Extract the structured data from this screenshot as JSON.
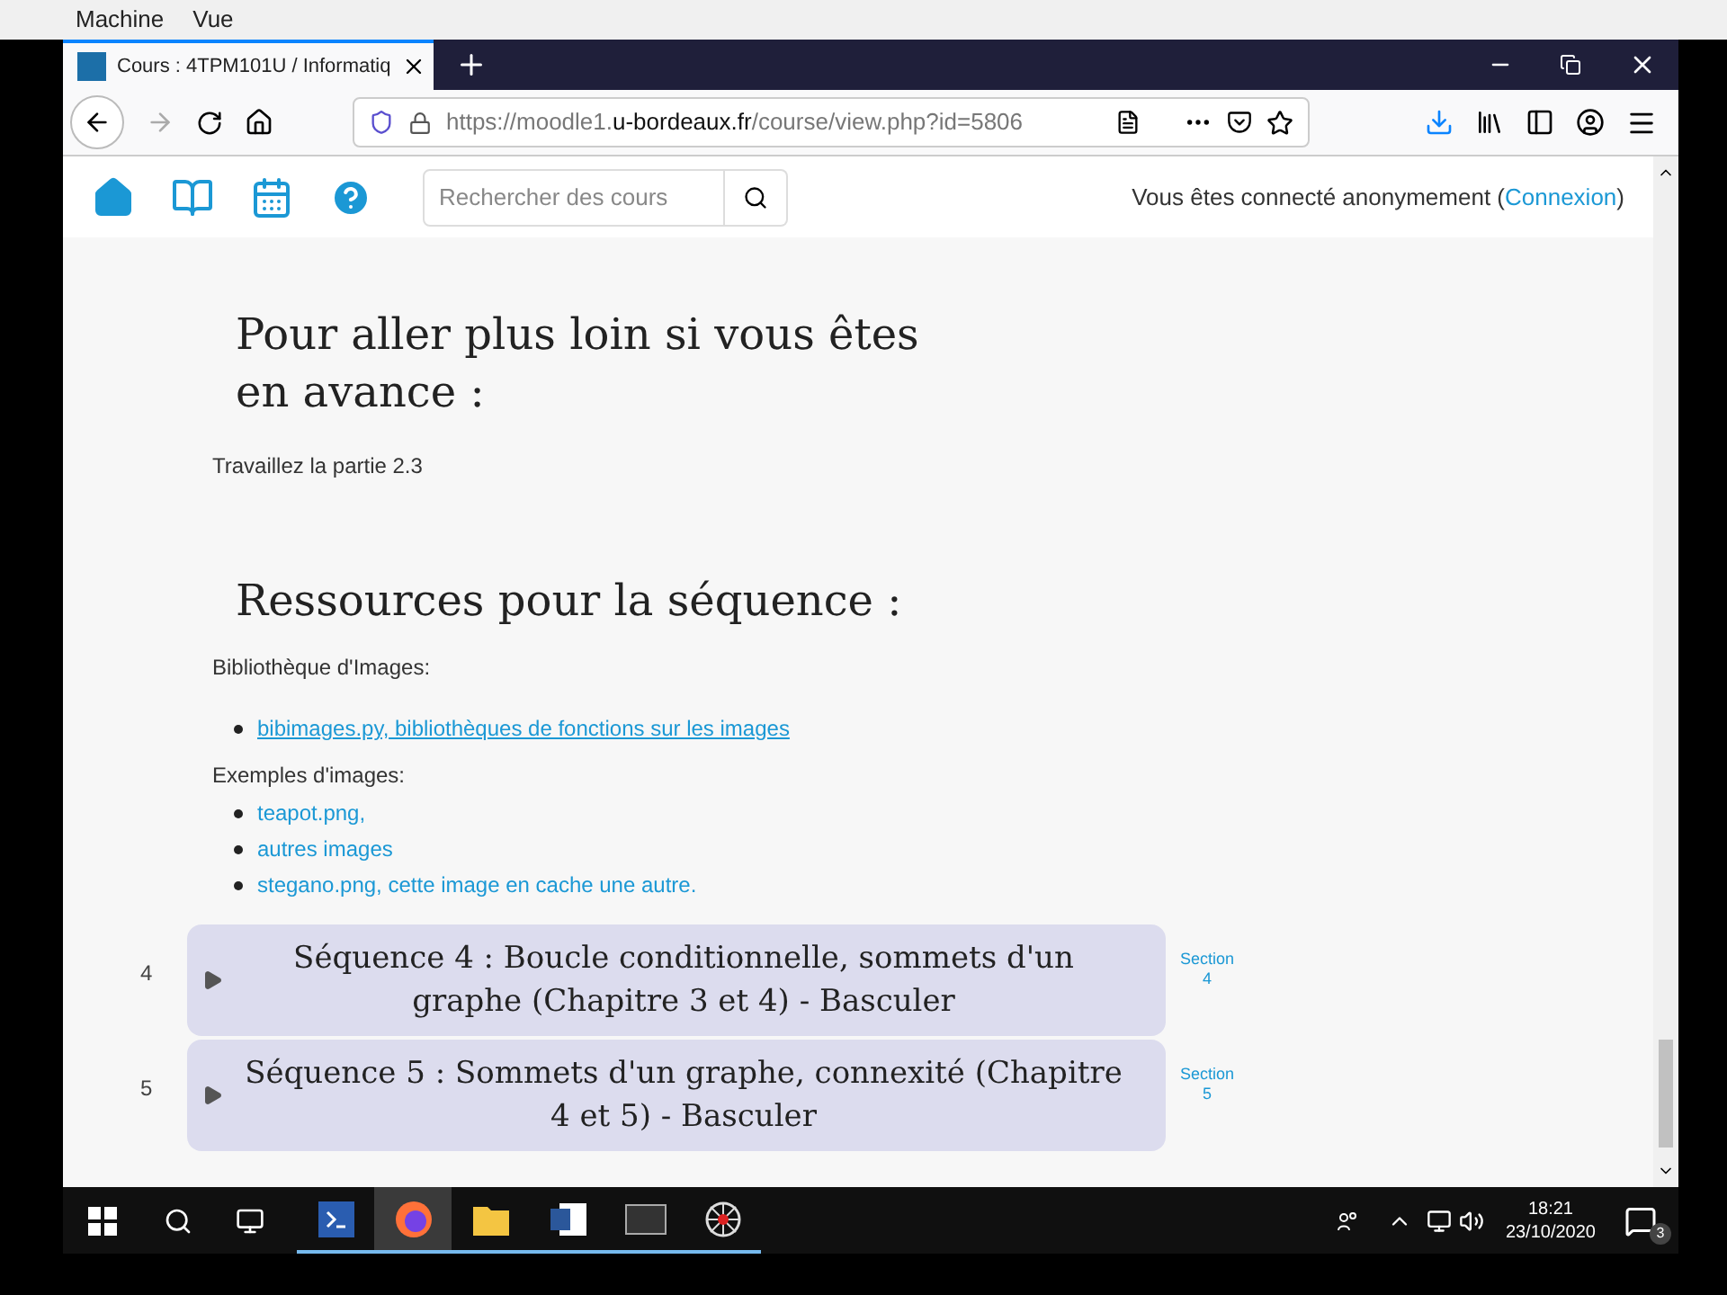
{
  "vm_menu": [
    "Machine",
    "Vue"
  ],
  "browser": {
    "tab_title": "Cours : 4TPM101U / Informatiq",
    "url_prefix": "https://moodle1.",
    "url_domain": "u-bordeaux.fr",
    "url_path": "/course/view.php?id=5806"
  },
  "moodle_header": {
    "search": {
      "placeholder": "Rechercher des cours"
    },
    "login_text": "Vous êtes connecté anonymement (",
    "login_link": "Connexion",
    "login_close": ")"
  },
  "content": {
    "heading_1": "Pour aller plus loin si vous êtes en avance :",
    "text_1": "Travaillez la partie 2.3",
    "heading_2": "Ressources pour la séquence :",
    "label_1": "Bibliothèque d'Images:",
    "list_1": [
      "bibimages.py, bibliothèques de fonctions sur les images"
    ],
    "label_2": "Exemples d'images:",
    "list_2": [
      "teapot.png,",
      "autres images",
      "stegano.png, cette image en cache une autre."
    ]
  },
  "sections": [
    {
      "number": "4",
      "title": "Séquence 4 : Boucle conditionnelle, sommets d'un graphe (Chapitre 3 et 4) - Basculer",
      "expanded": false,
      "link": [
        "Section",
        "4"
      ]
    },
    {
      "number": "5",
      "title": "Séquence 5 : Sommets d'un graphe, connexité (Chapitre 4 et 5) - Basculer",
      "expanded": false,
      "link": [
        "Section",
        "5"
      ]
    }
  ],
  "taskbar": {
    "apps": [
      {
        "kind": "powershell",
        "running": true,
        "selected": false
      },
      {
        "kind": "firefox",
        "running": true,
        "selected": true
      },
      {
        "kind": "explorer",
        "running": true,
        "selected": false
      },
      {
        "kind": "word",
        "running": true,
        "selected": false
      },
      {
        "kind": "terminal",
        "running": true,
        "selected": false
      },
      {
        "kind": "spider",
        "running": true,
        "selected": false
      }
    ],
    "time": "18:21",
    "date": "23/10/2020",
    "notifications": "3"
  }
}
